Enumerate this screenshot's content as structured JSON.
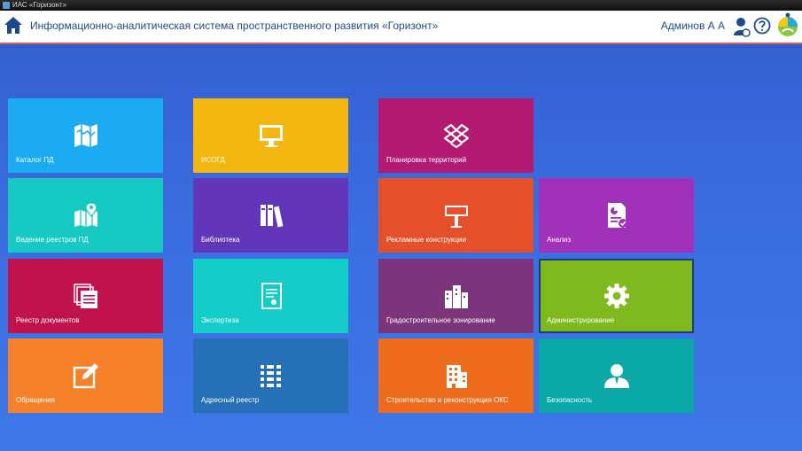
{
  "window": {
    "title": "ИАС «Горизонт»"
  },
  "header": {
    "app_title": "Информационно-аналитическая система пространственного развития «Горизонт»",
    "user_name": "Админов А А"
  },
  "tiles": [
    {
      "label": "Каталог ПД",
      "color": "#1aabf3",
      "icon": "map-icon"
    },
    {
      "label": "ИСОГД",
      "color": "#f3b70f",
      "icon": "monitor-icon"
    },
    {
      "label": "Планировка территорий",
      "color": "#b31a72",
      "icon": "dropbox-icon"
    },
    {
      "label": "Ведение реестров ПД",
      "color": "#17c9c3",
      "icon": "map-pin-icon"
    },
    {
      "label": "Библиотека",
      "color": "#6236b8",
      "icon": "books-icon"
    },
    {
      "label": "Рекламные конструкции",
      "color": "#e4502a",
      "icon": "billboard-icon"
    },
    {
      "label": "Анализ",
      "color": "#a131b8",
      "icon": "report-icon"
    },
    {
      "label": "Реестр документов",
      "color": "#c0124d",
      "icon": "documents-icon"
    },
    {
      "label": "Экспертиза",
      "color": "#14cdc8",
      "icon": "certificate-icon"
    },
    {
      "label": "Градостроительное зонирование",
      "color": "#7c347a",
      "icon": "buildings-icon"
    },
    {
      "label": "Администрирование",
      "color": "#7eba1d",
      "icon": "gear-icon"
    },
    {
      "label": "Обращения",
      "color": "#f5822b",
      "icon": "edit-icon"
    },
    {
      "label": "Адресный реестр",
      "color": "#2570b7",
      "icon": "list-icon"
    },
    {
      "label": "Строительство и реконструкция ОКС",
      "color": "#ee6c1d",
      "icon": "office-building-icon"
    },
    {
      "label": "Безопасность",
      "color": "#0ba8a8",
      "icon": "user-icon"
    }
  ]
}
